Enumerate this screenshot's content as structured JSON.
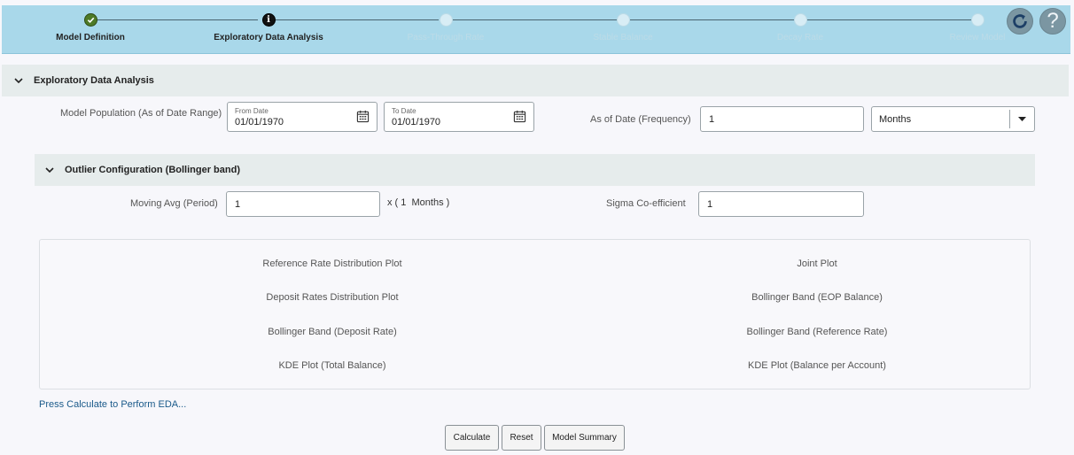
{
  "train": {
    "steps": [
      {
        "label": "Model Definition",
        "state": "done"
      },
      {
        "label": "Exploratory Data Analysis",
        "state": "current",
        "icon_char": "i"
      },
      {
        "label": "Pass-Through Rate",
        "state": "future"
      },
      {
        "label": "Stable Balance",
        "state": "future"
      },
      {
        "label": "Decay Rate",
        "state": "future"
      },
      {
        "label": "Review Model",
        "state": "future"
      }
    ],
    "help_symbol": "?"
  },
  "eda_section": {
    "title": "Exploratory Data Analysis",
    "model_population_label": "Model Population (As of Date Range)",
    "from_date": {
      "label": "From Date",
      "value": "01/01/1970"
    },
    "to_date": {
      "label": "To Date",
      "value": "01/01/1970"
    },
    "as_of_date_label": "As of Date (Frequency)",
    "frequency_value": "1",
    "frequency_unit": "Months"
  },
  "outlier_section": {
    "title": "Outlier Configuration (Bollinger band)",
    "moving_avg_label": "Moving Avg (Period)",
    "moving_avg_value": "1",
    "unit_text": "x ( 1  Months )",
    "sigma_label": "Sigma Co-efficient",
    "sigma_value": "1"
  },
  "plots": {
    "left": [
      "Reference Rate Distribution Plot",
      "Deposit Rates Distribution Plot",
      "Bollinger Band (Deposit Rate)",
      "KDE Plot (Total Balance)"
    ],
    "right": [
      "Joint Plot",
      "Bollinger Band (EOP Balance)",
      "Bollinger Band (Reference Rate)",
      "KDE Plot (Balance per Account)"
    ]
  },
  "hint_text": "Press Calculate to Perform EDA...",
  "buttons": {
    "calculate": "Calculate",
    "reset": "Reset",
    "model_summary": "Model Summary"
  },
  "colors": {
    "train_bg": "#a9d8ea",
    "done": "#4e7a27",
    "current": "#111111",
    "link": "#1a5a8a"
  },
  "icons": {
    "step_done": "check-icon",
    "step_current": "info-icon",
    "refresh": "refresh-icon",
    "help": "help-icon",
    "section_toggle": "chevron-down-icon",
    "date_picker": "calendar-icon",
    "select_toggle": "caret-down-icon"
  }
}
